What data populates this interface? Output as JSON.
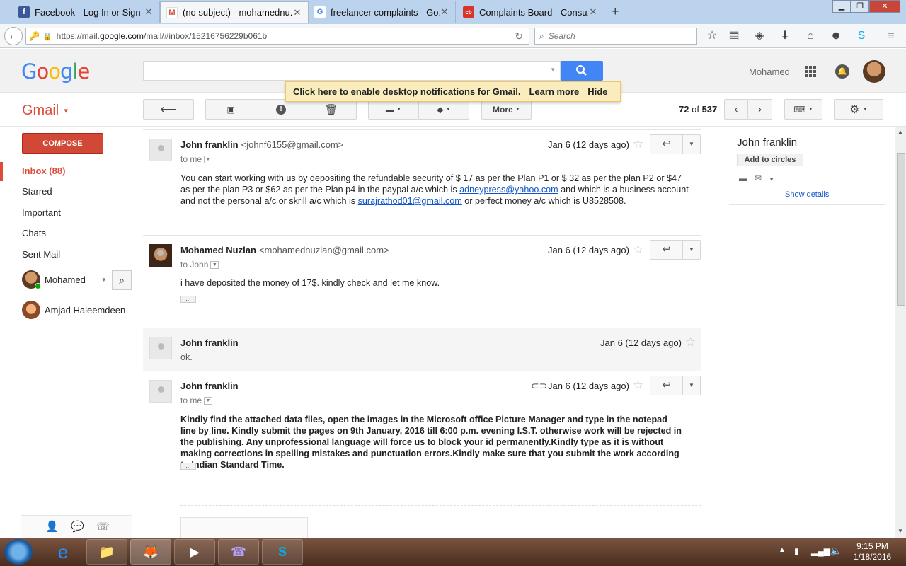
{
  "browser": {
    "tabs": [
      {
        "title": "Facebook - Log In or Sign ...",
        "favicon_color": "#3b5998",
        "favicon_glyph": "f"
      },
      {
        "title": "(no subject) - mohamednu...",
        "favicon_color": "#ffffff",
        "favicon_glyph": "M"
      },
      {
        "title": "freelancer complaints - Go...",
        "favicon_color": "#ffffff",
        "favicon_glyph": "G"
      },
      {
        "title": "Complaints Board - Consu...",
        "favicon_color": "#d9342b",
        "favicon_glyph": "cb"
      }
    ],
    "new_tab": "+",
    "url_prefix": "https://mail.",
    "url_domain": "google.com",
    "url_path": "/mail/#inbox/15216756229b061b",
    "search_placeholder": "Search"
  },
  "gmail": {
    "logo": "Google",
    "user_name": "Mohamed",
    "notification": {
      "link": "Click here to enable",
      "text": "desktop notifications for Gmail.",
      "learn_more": "Learn more",
      "hide": "Hide"
    },
    "label": "Gmail",
    "more_label": "More",
    "pager": {
      "current": "72",
      "of": "of",
      "total": "537"
    },
    "compose": "COMPOSE",
    "nav": [
      {
        "label": "Inbox (88)"
      },
      {
        "label": "Starred"
      },
      {
        "label": "Important"
      },
      {
        "label": "Chats"
      },
      {
        "label": "Sent Mail"
      }
    ],
    "chat_user": "Mohamed",
    "contacts": [
      "Amjad Haleemdeen"
    ]
  },
  "messages": [
    {
      "sender": "John franklin",
      "email": "<johnf6155@gmail.com>",
      "to": "to me",
      "date": "Jan 6 (12 days ago)",
      "body_parts": [
        "You can start working with us by depositing the refundable security of $ 17 as per the Plan P1 or $ 32 as per the plan P2 or $47 as per the plan P3 or $62 as per the Plan p4 in the paypal a/c which is ",
        "adneypress@yahoo.com",
        " and which is a business account and not the personal a/c  or skrill a/c which is ",
        "surajrathod01@gmail.com",
        " or perfect money a/c which is U8528508."
      ]
    },
    {
      "sender": "Mohamed Nuzlan",
      "email": "<mohamednuzlan@gmail.com>",
      "to": "to John",
      "date": "Jan 6 (12 days ago)",
      "body": "i have deposited the money of 17$. kindly check and let me know.",
      "ellipsis": "..."
    },
    {
      "sender": "John franklin",
      "date": "Jan 6 (12 days ago)",
      "body": "ok."
    },
    {
      "sender": "John franklin",
      "to": "to me",
      "date": "Jan 6 (12 days ago)",
      "body": "Kindly find the attached data files, open the images in the Microsoft office Picture Manager and type in the notepad line by line. Kindly submit the pages on 9th January, 2016 till 6:00 p.m. evening I.S.T. otherwise work will be rejected in the publishing. Any unprofessional language will force us to block your id permanently.Kindly type as it is without making corrections in spelling mistakes and punctuation errors.Kindly make sure that you submit the work according to Indian Standard Time.",
      "ellipsis": "..."
    }
  ],
  "contact_panel": {
    "name": "John franklin",
    "add_to_circles": "Add to circles",
    "show_details": "Show details"
  },
  "taskbar": {
    "time": "9:15 PM",
    "date": "1/18/2016"
  }
}
